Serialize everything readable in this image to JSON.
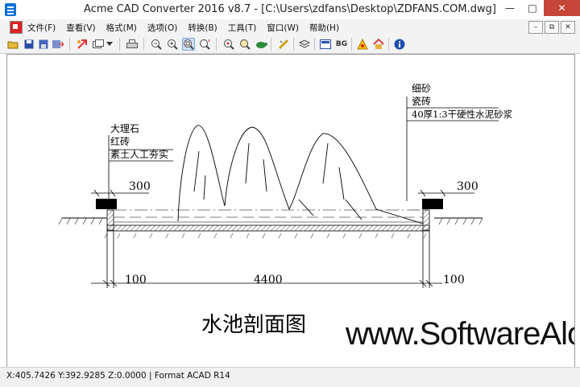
{
  "window": {
    "title": "Acme CAD Converter 2016 v8.7 - [C:\\Users\\zdfans\\Desktop\\ZDFANS.COM.dwg]",
    "minimize_icon": "minimize-icon",
    "maximize_icon": "maximize-icon",
    "close_icon": "close-icon"
  },
  "menu": {
    "items": [
      "文件(F)",
      "查看(V)",
      "格式(M)",
      "选项(O)",
      "转换(B)",
      "工具(T)",
      "窗口(W)",
      "帮助(H)"
    ]
  },
  "toolbar": {
    "buttons": [
      "open-icon",
      "save-icon",
      "save-as-icon",
      "export-icon",
      "convert-icon",
      "batch-icon",
      "dropdown-icon",
      "print-icon",
      "zoom-out-icon",
      "zoom-in-icon",
      "zoom-window-icon",
      "zoom-realtime-icon",
      "pan-icon",
      "find-icon",
      "layers-icon",
      "turtle-icon",
      "measure-icon",
      "pen-icon",
      "layout-icon",
      "background-icon",
      "bg-toggle-icon",
      "warning-icon",
      "home-icon",
      "info-icon"
    ],
    "bg_label": "BG",
    "active_button": "zoom-window-icon"
  },
  "drawing": {
    "title": "水池剖面图",
    "left_labels": [
      "大理石",
      "红砖",
      "素土人工夯实"
    ],
    "right_labels": [
      "细砂",
      "瓷砖",
      "40厚1:3干硬性水泥砂浆"
    ],
    "dims": {
      "left_top": "300",
      "right_top": "300",
      "bottom_left": "100",
      "bottom_mid": "4400",
      "bottom_right": "100"
    },
    "watermark": "www.SoftwareAlots.com"
  },
  "status": {
    "text": "X:405.7426 Y:392.9285 Z:0.0000 | Format ACAD R14"
  }
}
